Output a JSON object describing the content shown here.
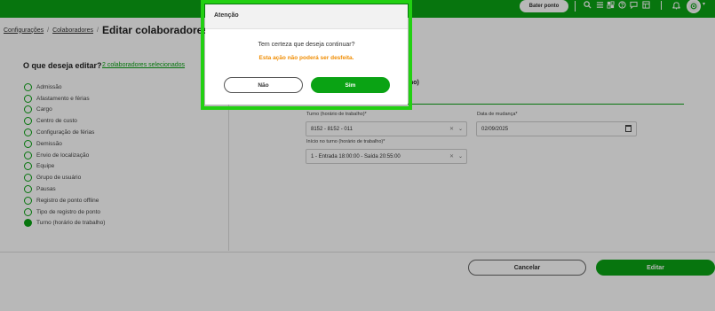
{
  "header": {
    "punch_button": "Bater ponto",
    "icons": [
      "search-icon",
      "list-icon",
      "puzzle-icon",
      "help-icon",
      "chat-icon",
      "grid-icon",
      "bell-icon"
    ],
    "user_avatar": "user-avatar"
  },
  "breadcrumb": {
    "items": [
      "Configurações",
      "Colaboradores"
    ],
    "current": "Editar colaboradores"
  },
  "left_panel": {
    "title": "O que deseja editar?",
    "selected_link": "2 colaboradores selecionados",
    "options": [
      {
        "label": "Admissão",
        "checked": false
      },
      {
        "label": "Afastamento e férias",
        "checked": false
      },
      {
        "label": "Cargo",
        "checked": false
      },
      {
        "label": "Centro de custo",
        "checked": false
      },
      {
        "label": "Configuração de férias",
        "checked": false
      },
      {
        "label": "Demissão",
        "checked": false
      },
      {
        "label": "Envio de localização",
        "checked": false
      },
      {
        "label": "Equipe",
        "checked": false
      },
      {
        "label": "Grupo de usuário",
        "checked": false
      },
      {
        "label": "Pausas",
        "checked": false
      },
      {
        "label": "Registro de ponto offline",
        "checked": false
      },
      {
        "label": "Tipo de registro de ponto",
        "checked": false
      },
      {
        "label": "Turno (horário de trabalho)",
        "checked": true
      }
    ]
  },
  "form": {
    "section_fragment": "ho)",
    "shift_label": "Turno (horário de trabalho)*",
    "shift_value": "8152 - 8152 - 011",
    "change_date_label": "Data de mudança*",
    "change_date_value": "02/09/2025",
    "shift_start_label": "Início no turno (horário de trabalho)*",
    "shift_start_value": "1 - Entrada 18:00:00 - Saída 20:55:00"
  },
  "footer": {
    "cancel": "Cancelar",
    "edit": "Editar"
  },
  "modal": {
    "title": "Atenção",
    "message": "Tem certeza que deseja continuar?",
    "warning": "Esta ação não poderá ser desfeita.",
    "no": "Não",
    "yes": "Sim"
  },
  "colors": {
    "brand": "#0aa314",
    "warning": "#f08c00",
    "highlight": "#22d012"
  }
}
